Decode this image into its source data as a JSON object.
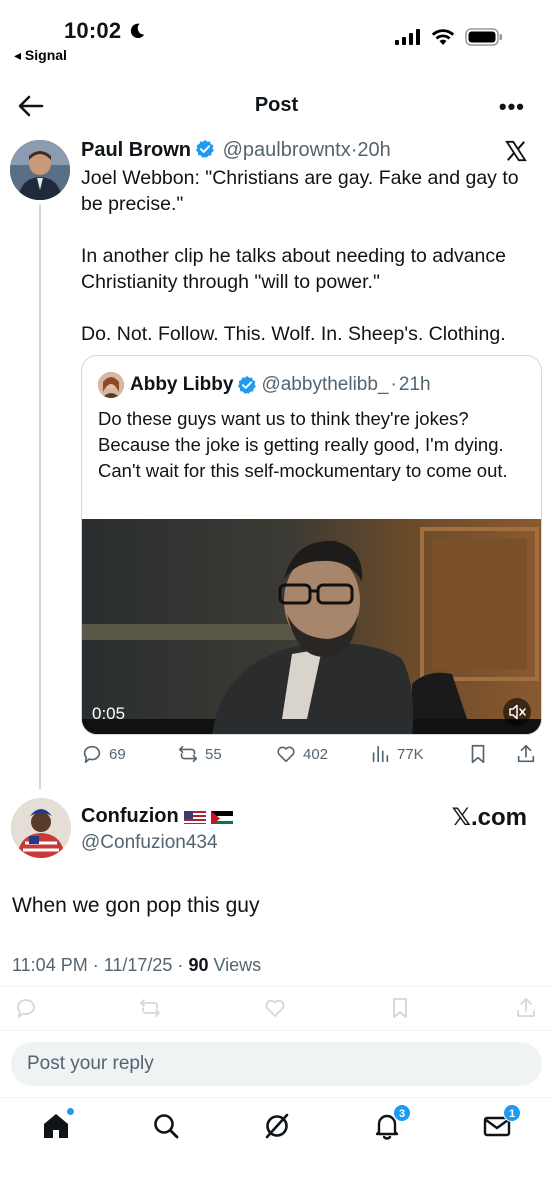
{
  "status_bar": {
    "time": "10:02",
    "back_app": "◂ Signal"
  },
  "header": {
    "title": "Post"
  },
  "main_post": {
    "author_name": "Paul Brown",
    "handle": "@paulbrowntx",
    "age": "20h",
    "paragraphs": [
      "Joel Webbon: \"Christians are gay. Fake and gay to be precise.\"",
      "In another clip he talks about needing to advance Christianity through \"will to power.\"",
      "Do. Not. Follow. This. Wolf. In. Sheep's. Clothing."
    ],
    "quote": {
      "author_name": "Abby Libby",
      "handle": "@abbythelibb_",
      "age": "21h",
      "text": "Do these guys want us to think they're jokes? Because the joke is getting really good, I'm dying. Can't wait for this self-mockumentary to come out.",
      "video_time": "0:05"
    },
    "stats": {
      "replies": "69",
      "reposts": "55",
      "likes": "402",
      "views": "77K"
    }
  },
  "reply_post": {
    "author_name": "Confuzion",
    "handle": "@Confuzion434",
    "watermark": "𝕏.com",
    "text": "When we gon pop this guy",
    "timestamp": "11:04 PM · 11/17/25 · ",
    "views_count": "90",
    "views_label": " Views"
  },
  "reply_input": {
    "placeholder": "Post your reply"
  },
  "tab_bar": {
    "notifications_badge": "3",
    "messages_badge": "1"
  },
  "colors": {
    "accent": "#1d9bf0",
    "secondary_text": "#536471",
    "border": "#cfd9de"
  }
}
